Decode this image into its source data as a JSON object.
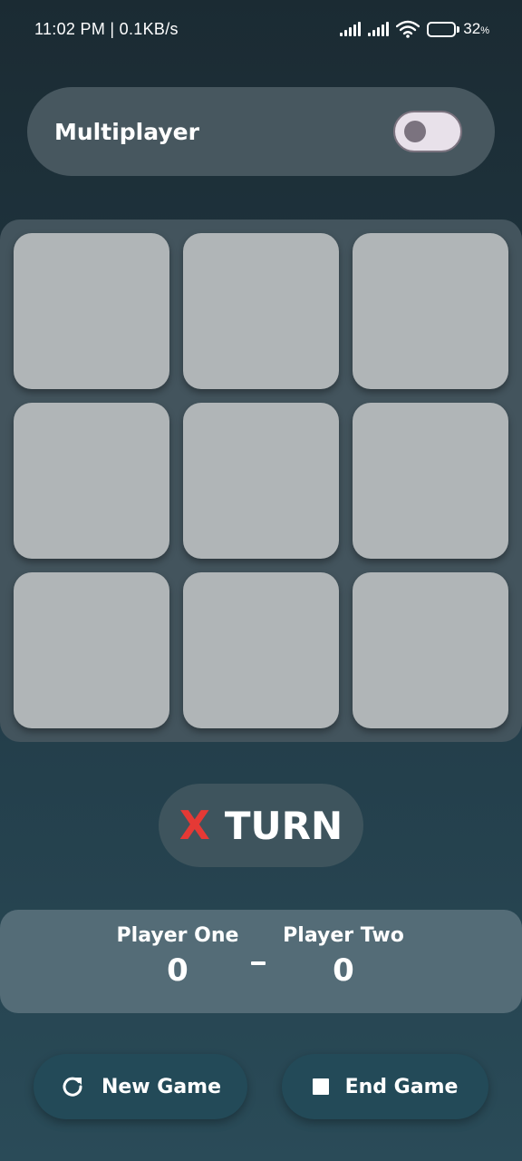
{
  "status_bar": {
    "time": "11:02 PM | 0.1KB/s",
    "battery_percent": "32",
    "battery_unit": "%",
    "battery_level": 0.32
  },
  "mode_panel": {
    "label": "Multiplayer",
    "toggle_on": false
  },
  "board": {
    "cells": [
      "",
      "",
      "",
      "",
      "",
      "",
      "",
      "",
      ""
    ]
  },
  "turn": {
    "mark": "X",
    "word": "TURN",
    "mark_color": "#e53935"
  },
  "scoreboard": {
    "player_one": {
      "name": "Player One",
      "score": "0"
    },
    "player_two": {
      "name": "Player Two",
      "score": "0"
    }
  },
  "actions": {
    "new_game_label": "New Game",
    "end_game_label": "End Game"
  },
  "icons": {
    "new_game": "refresh-icon",
    "end_game": "stop-icon"
  }
}
